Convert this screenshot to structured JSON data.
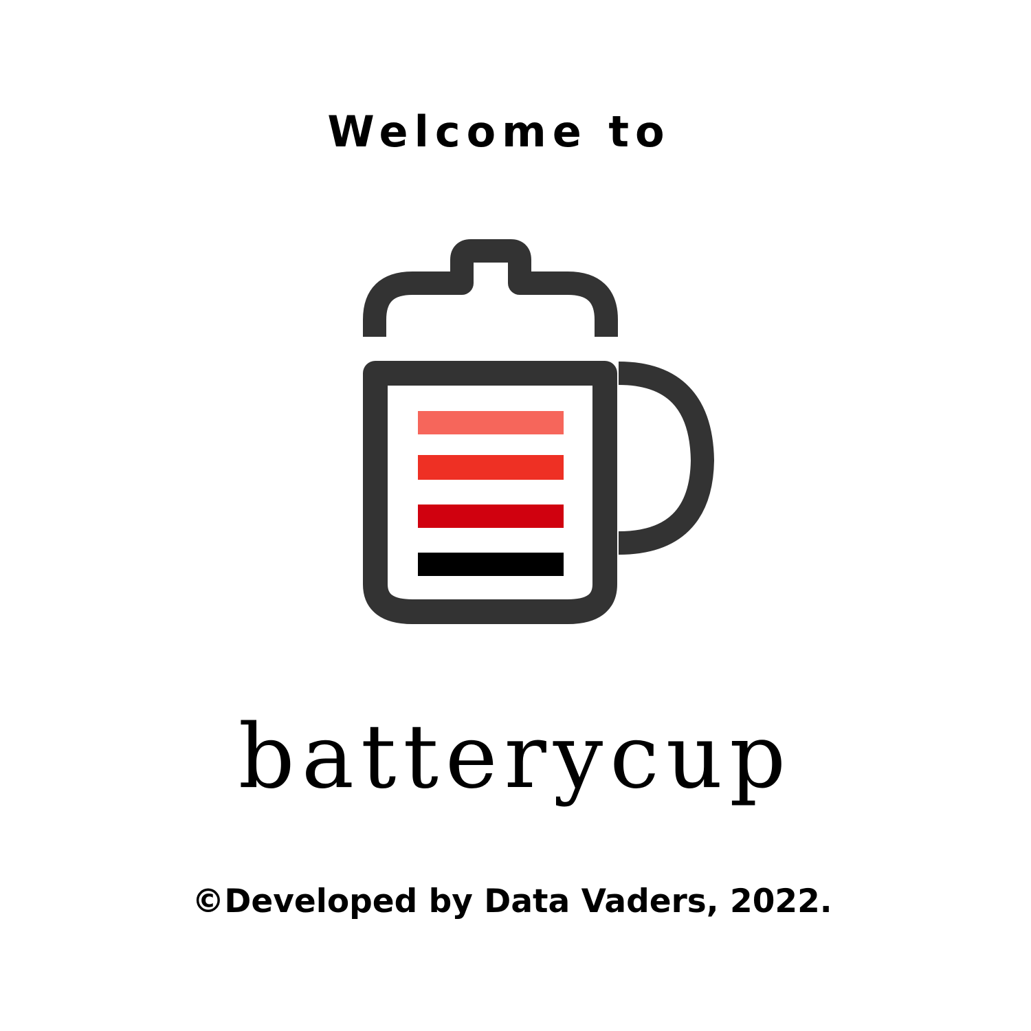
{
  "welcome_text": "Welcome to",
  "app_name": "batterycup",
  "copyright": "©Developed by Data Vaders, 2022.",
  "logo": {
    "icon": "battery-cup-icon",
    "outline_color": "#333333",
    "charge_bar_colors": [
      "#f6665b",
      "#ee3024",
      "#d0010f",
      "#000000"
    ],
    "charge_level": "4 of 4 bars"
  }
}
